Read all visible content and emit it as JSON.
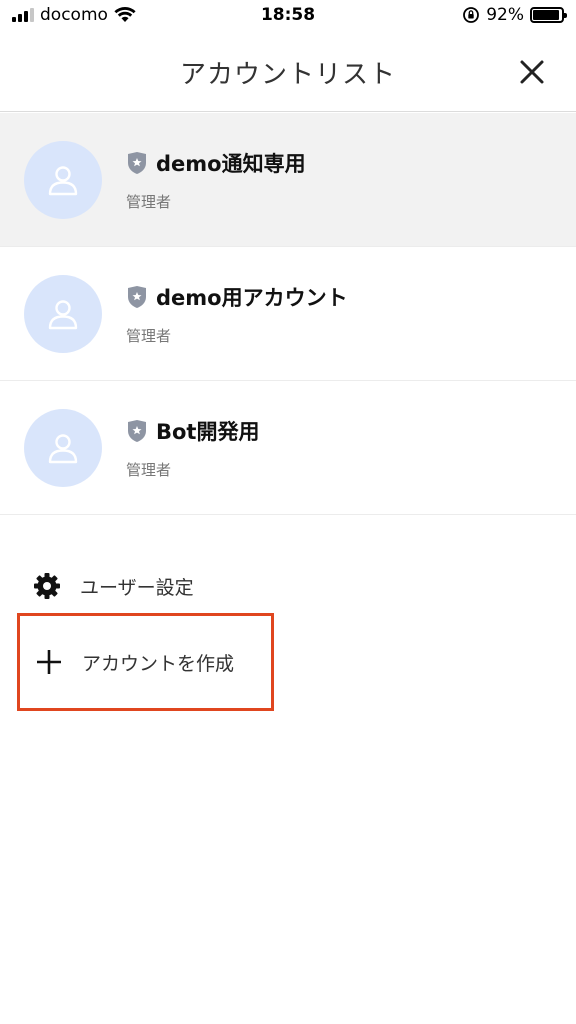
{
  "status_bar": {
    "carrier": "docomo",
    "time": "18:58",
    "battery_text": "92%",
    "battery_level": 0.92
  },
  "header": {
    "title": "アカウントリスト"
  },
  "accounts": [
    {
      "name": "demo通知専用",
      "role": "管理者",
      "selected": true
    },
    {
      "name": "demo用アカウント",
      "role": "管理者",
      "selected": false
    },
    {
      "name": "Bot開発用",
      "role": "管理者",
      "selected": false
    }
  ],
  "menu": {
    "user_settings_label": "ユーザー設定",
    "create_account_label": "アカウントを作成"
  },
  "colors": {
    "avatar_bg": "#d9e5fb",
    "highlight_border": "#e0461f",
    "selected_row_bg": "#f2f2f2"
  }
}
